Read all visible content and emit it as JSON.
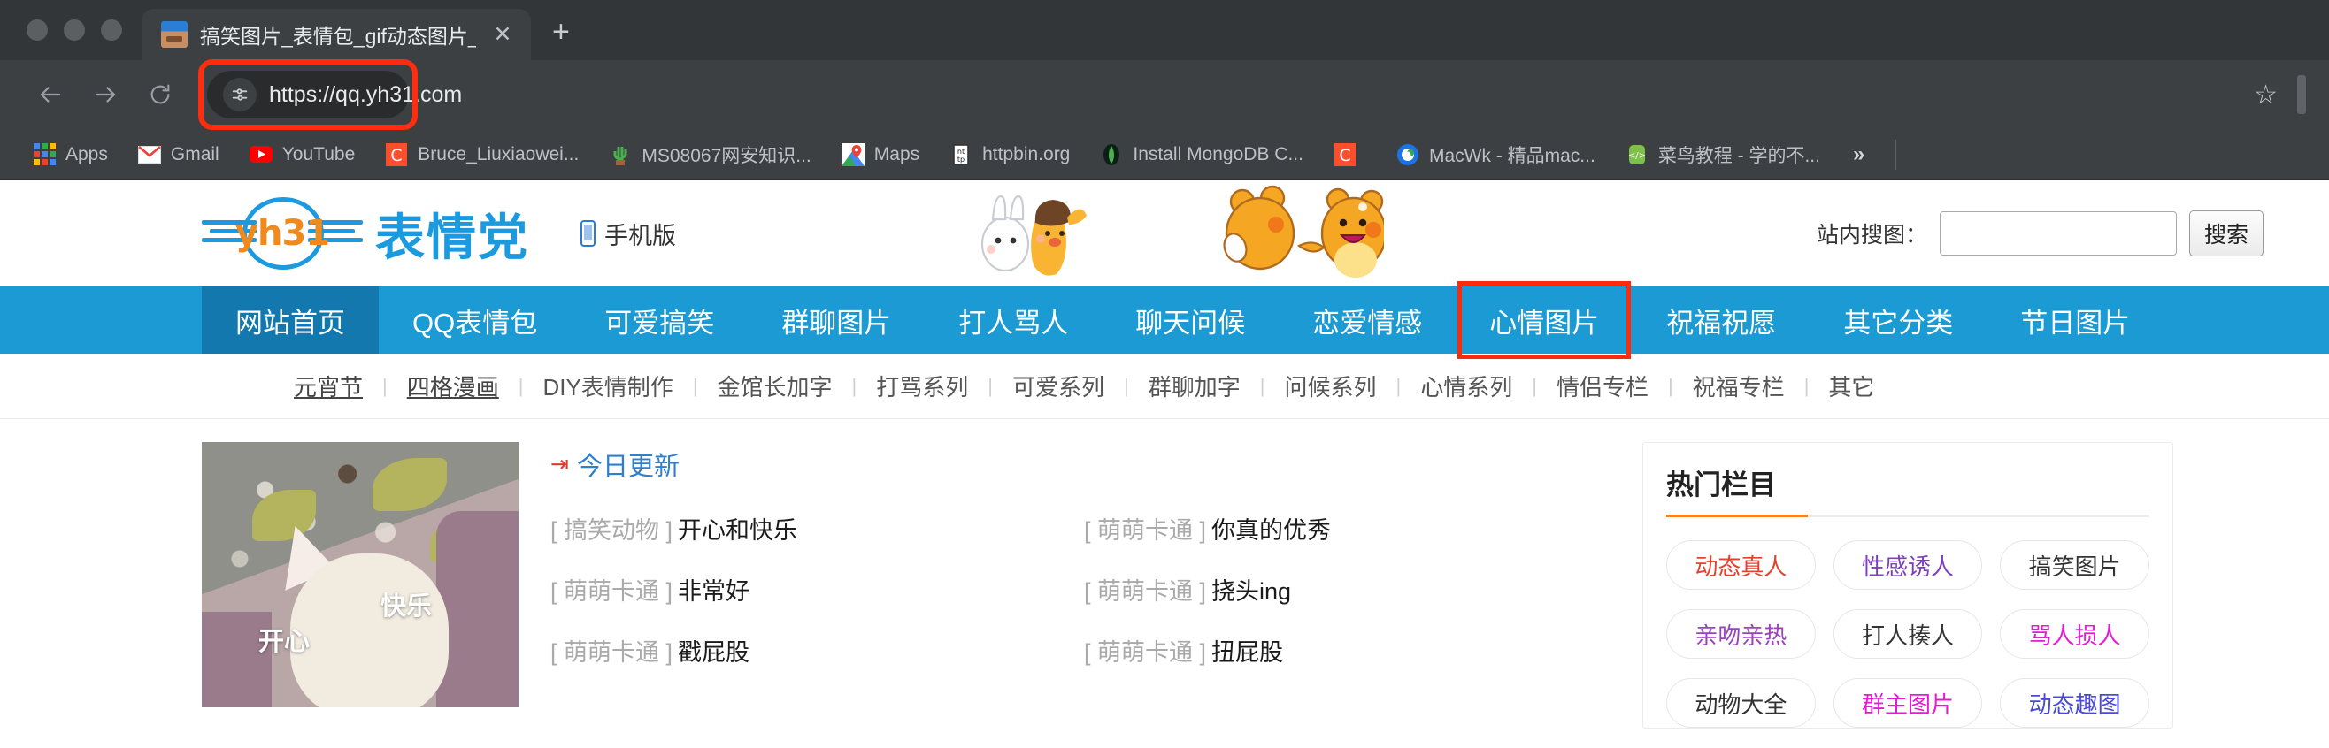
{
  "browser": {
    "tab": {
      "title": "搞笑图片_表情包_gif动态图片_",
      "close_label": "✕",
      "favicon": "page-favicon"
    },
    "new_tab_label": "+",
    "nav": {
      "back": "back-arrow",
      "forward": "forward-arrow",
      "reload": "reload-icon"
    },
    "omnibox": {
      "url": "https://qq.yh31.com",
      "site_info_icon": "site-settings-icon",
      "highlight_color": "#ff2d0f"
    },
    "bookmark_star": "☆",
    "bookmarks": [
      {
        "label": "Apps",
        "icon": "apps-grid-icon"
      },
      {
        "label": "Gmail",
        "icon": "gmail-icon"
      },
      {
        "label": "YouTube",
        "icon": "youtube-icon"
      },
      {
        "label": "Bruce_Liuxiaowei...",
        "icon": "c-icon"
      },
      {
        "label": "MS08067网安知识...",
        "icon": "cactus-icon"
      },
      {
        "label": "Maps",
        "icon": "google-maps-icon"
      },
      {
        "label": "httpbin.org",
        "icon": "httpbin-icon"
      },
      {
        "label": "Install MongoDB C...",
        "icon": "mongodb-icon"
      },
      {
        "label": "",
        "icon": "c-icon"
      },
      {
        "label": "MacWk - 精品mac...",
        "icon": "macwk-icon"
      },
      {
        "label": "菜鸟教程 - 学的不...",
        "icon": "runoob-icon"
      }
    ],
    "bookmarks_overflow": "»"
  },
  "site": {
    "logo": {
      "en": "yh31",
      "cn": "表情党"
    },
    "mobile_link": "手机版",
    "search": {
      "label": "站内搜图：",
      "value": "",
      "placeholder": "",
      "button": "搜索"
    },
    "main_nav": [
      {
        "label": "网站首页",
        "active": true,
        "boxed": false
      },
      {
        "label": "QQ表情包",
        "active": false,
        "boxed": false
      },
      {
        "label": "可爱搞笑",
        "active": false,
        "boxed": false
      },
      {
        "label": "群聊图片",
        "active": false,
        "boxed": false
      },
      {
        "label": "打人骂人",
        "active": false,
        "boxed": false
      },
      {
        "label": "聊天问候",
        "active": false,
        "boxed": false
      },
      {
        "label": "恋爱情感",
        "active": false,
        "boxed": false
      },
      {
        "label": "心情图片",
        "active": false,
        "boxed": true
      },
      {
        "label": "祝福祝愿",
        "active": false,
        "boxed": false
      },
      {
        "label": "其它分类",
        "active": false,
        "boxed": false
      },
      {
        "label": "节日图片",
        "active": false,
        "boxed": false
      }
    ],
    "sub_nav": [
      {
        "label": "元宵节",
        "underline": true
      },
      {
        "label": "四格漫画",
        "underline": true
      },
      {
        "label": "DIY表情制作",
        "underline": false
      },
      {
        "label": "金馆长加字",
        "underline": false
      },
      {
        "label": "打骂系列",
        "underline": false
      },
      {
        "label": "可爱系列",
        "underline": false
      },
      {
        "label": "群聊加字",
        "underline": false
      },
      {
        "label": "问候系列",
        "underline": false
      },
      {
        "label": "心情系列",
        "underline": false
      },
      {
        "label": "情侣专栏",
        "underline": false
      },
      {
        "label": "祝福专栏",
        "underline": false
      },
      {
        "label": "其它",
        "underline": false
      }
    ],
    "thumbnail": {
      "caption_left": "开心",
      "caption_right": "快乐",
      "alt": "cat-emoticon-thumbnail"
    },
    "updates": {
      "title": "今日更新",
      "items": [
        {
          "category": "[ 搞笑动物 ]",
          "name": "开心和快乐"
        },
        {
          "category": "[ 萌萌卡通 ]",
          "name": "你真的优秀"
        },
        {
          "category": "[ 萌萌卡通 ]",
          "name": "非常好"
        },
        {
          "category": "[ 萌萌卡通 ]",
          "name": "挠头ing"
        },
        {
          "category": "[ 萌萌卡通 ]",
          "name": "戳屁股"
        },
        {
          "category": "[ 萌萌卡通 ]",
          "name": "扭屁股"
        }
      ]
    },
    "hot_panel": {
      "title": "热门栏目",
      "accent_color": "#f58220",
      "tags": [
        {
          "label": "动态真人",
          "color": "#e8402a"
        },
        {
          "label": "性感诱人",
          "color": "#7d3fbf"
        },
        {
          "label": "搞笑图片",
          "color": "#333333"
        },
        {
          "label": "亲吻亲热",
          "color": "#9b3fc4"
        },
        {
          "label": "打人揍人",
          "color": "#333333"
        },
        {
          "label": "骂人损人",
          "color": "#e619d8"
        },
        {
          "label": "动物大全",
          "color": "#333333"
        },
        {
          "label": "群主图片",
          "color": "#e619d8"
        },
        {
          "label": "动态趣图",
          "color": "#4a4ad8"
        }
      ]
    }
  }
}
